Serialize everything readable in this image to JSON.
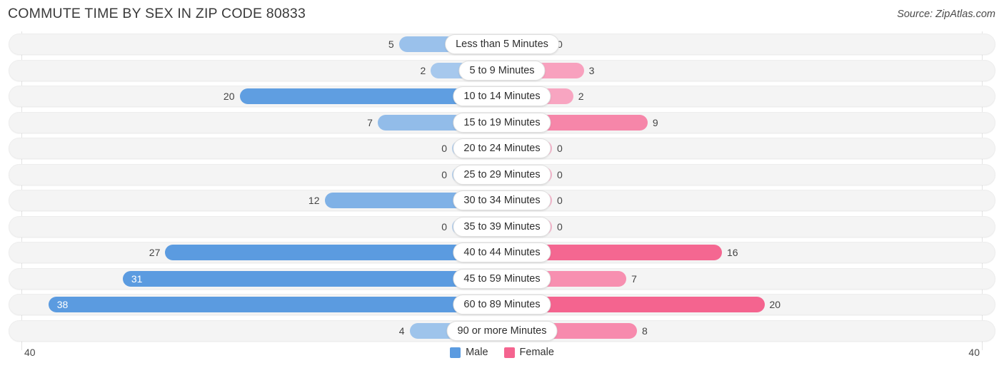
{
  "header": {
    "title": "COMMUTE TIME BY SEX IN ZIP CODE 80833",
    "source": "Source: ZipAtlas.com"
  },
  "legend": {
    "male_label": "Male",
    "female_label": "Female",
    "male_color": "#5b9be0",
    "female_color": "#f4648f"
  },
  "axis": {
    "left_label": "40",
    "right_label": "40",
    "max": 40
  },
  "chart_data": {
    "type": "bar",
    "orientation": "horizontal-diverging",
    "title": "Commute Time by Sex in Zip Code 80833",
    "xlabel": "",
    "ylabel": "",
    "xlim": [
      40,
      40
    ],
    "grid": true,
    "legend_position": "bottom-center",
    "categories": [
      "Less than 5 Minutes",
      "5 to 9 Minutes",
      "10 to 14 Minutes",
      "15 to 19 Minutes",
      "20 to 24 Minutes",
      "25 to 29 Minutes",
      "30 to 34 Minutes",
      "35 to 39 Minutes",
      "40 to 44 Minutes",
      "45 to 59 Minutes",
      "60 to 89 Minutes",
      "90 or more Minutes"
    ],
    "series": [
      {
        "name": "Male",
        "values": [
          5,
          2,
          20,
          7,
          0,
          0,
          12,
          0,
          27,
          31,
          38,
          4
        ]
      },
      {
        "name": "Female",
        "values": [
          0,
          3,
          2,
          9,
          0,
          0,
          0,
          0,
          16,
          7,
          20,
          8
        ]
      }
    ]
  }
}
